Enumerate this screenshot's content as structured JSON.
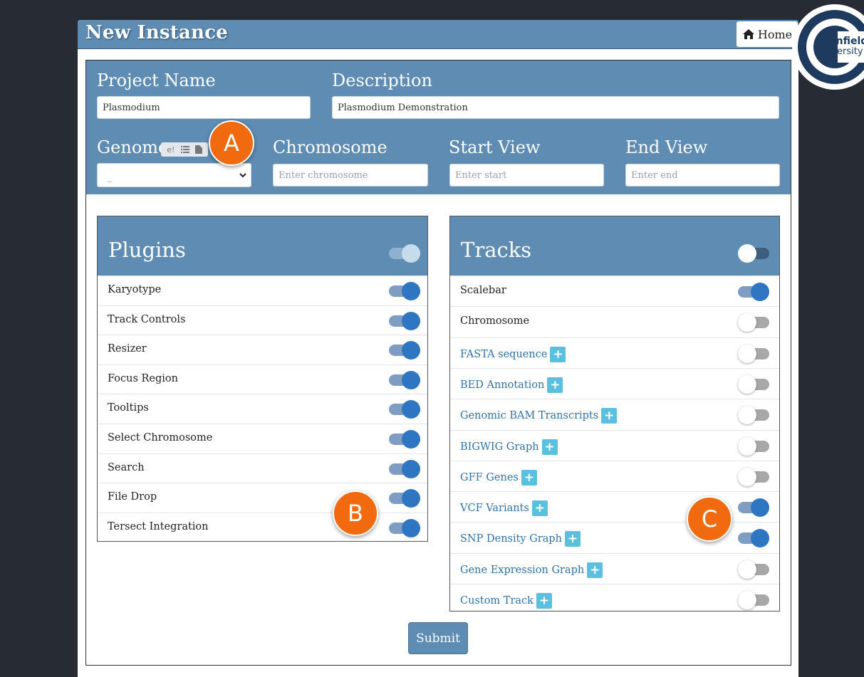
{
  "window": {
    "title": "New Instance",
    "home_label": "Home"
  },
  "logo": {
    "line1": "Cranfield",
    "line2": "University"
  },
  "form": {
    "project_name": {
      "label": "Project Name",
      "value": "Plasmodium"
    },
    "description": {
      "label": "Description",
      "value": "Plasmodium Demonstration"
    },
    "genome": {
      "label": "Genome",
      "selected": "_",
      "tool_icons": [
        "ensembl-icon",
        "list-icon",
        "file-icon"
      ],
      "tool_e_label": "e!"
    },
    "chromosome": {
      "label": "Chromosome",
      "placeholder": "Enter chromosome"
    },
    "start_view": {
      "label": "Start View",
      "placeholder": "Enter start"
    },
    "end_view": {
      "label": "End View",
      "placeholder": "Enter end"
    }
  },
  "plugins": {
    "title": "Plugins",
    "header_toggle": "on",
    "items": [
      {
        "label": "Karyotype",
        "on": true
      },
      {
        "label": "Track Controls",
        "on": true
      },
      {
        "label": "Resizer",
        "on": true
      },
      {
        "label": "Focus Region",
        "on": true
      },
      {
        "label": "Tooltips",
        "on": true
      },
      {
        "label": "Select Chromosome",
        "on": true
      },
      {
        "label": "Search",
        "on": true
      },
      {
        "label": "File Drop",
        "on": true
      },
      {
        "label": "Tersect Integration",
        "on": true
      }
    ]
  },
  "tracks": {
    "title": "Tracks",
    "header_toggle": "off",
    "items": [
      {
        "label": "Scalebar",
        "on": true,
        "link": false
      },
      {
        "label": "Chromosome",
        "on": false,
        "link": false
      },
      {
        "label": "FASTA sequence",
        "on": false,
        "link": true
      },
      {
        "label": "BED Annotation",
        "on": false,
        "link": true
      },
      {
        "label": "Genomic BAM Transcripts",
        "on": false,
        "link": true
      },
      {
        "label": "BIGWIG Graph",
        "on": false,
        "link": true
      },
      {
        "label": "GFF Genes",
        "on": false,
        "link": true
      },
      {
        "label": "VCF Variants",
        "on": true,
        "link": true
      },
      {
        "label": "SNP Density Graph",
        "on": true,
        "link": true
      },
      {
        "label": "Gene Expression Graph",
        "on": false,
        "link": true
      },
      {
        "label": "Custom Track",
        "on": false,
        "link": true
      }
    ]
  },
  "badges": {
    "a": "A",
    "b": "B",
    "c": "C"
  },
  "submit_label": "Submit",
  "colors": {
    "header_blue": "#5e8cb3",
    "toggle_on": "#2f76c2",
    "badge_orange": "#f26a10",
    "plus_button": "#5bc0de"
  }
}
